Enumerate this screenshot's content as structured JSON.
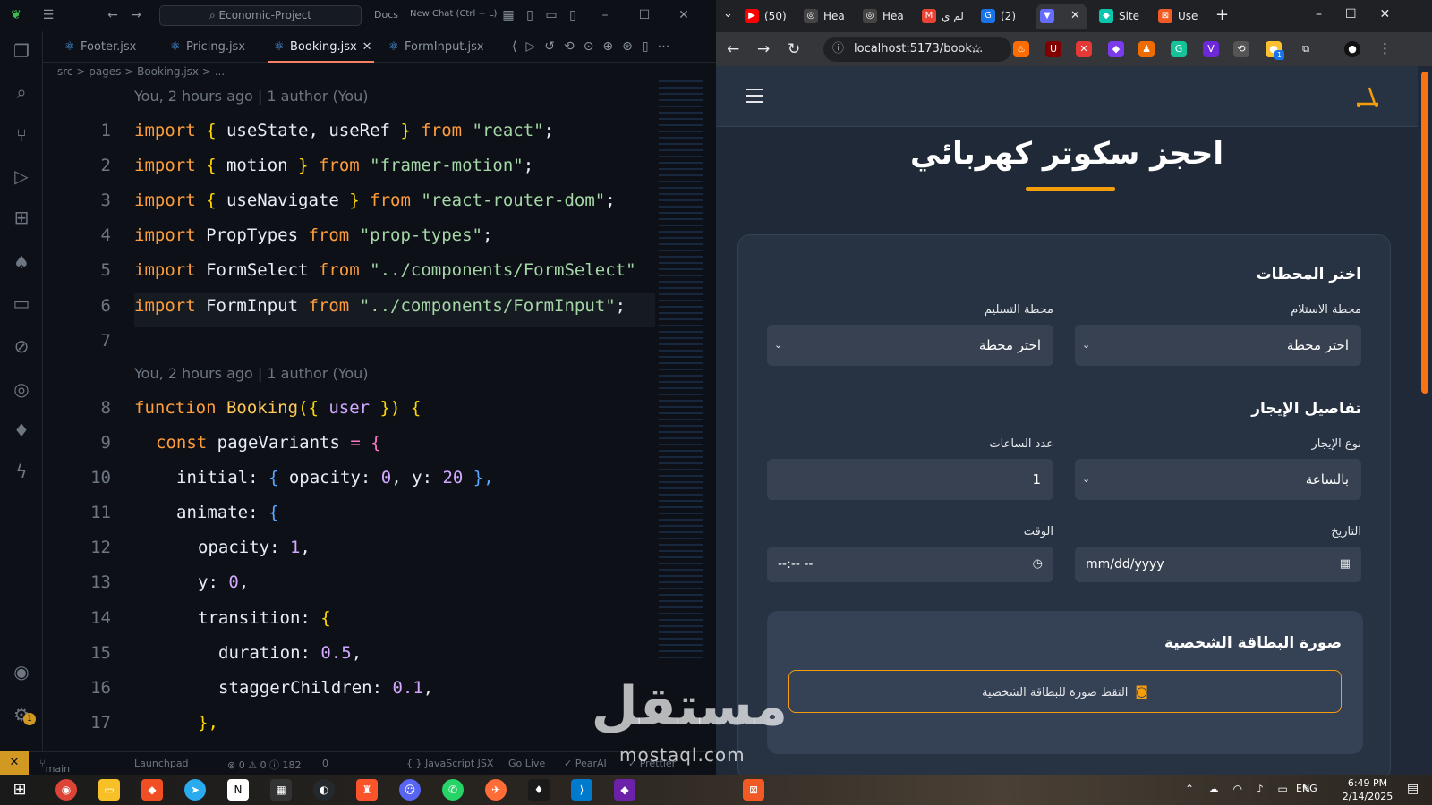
{
  "vscode": {
    "search": "Economic-Project",
    "docs": "Docs",
    "new_chat": "New Chat (Ctrl + L)",
    "tabs": [
      {
        "label": "Footer.jsx"
      },
      {
        "label": "Pricing.jsx"
      },
      {
        "label": "Booking.jsx"
      },
      {
        "label": "FormInput.jsx"
      }
    ],
    "tab_close": "✕",
    "breadcrumb": "src > pages > Booking.jsx > ...",
    "blame1": "You, 2 hours ago | 1 author (You)",
    "blame2": "You, 2 hours ago | 1 author (You)",
    "line_numbers": [
      "1",
      "2",
      "3",
      "4",
      "5",
      "6",
      "7",
      "8",
      "9",
      "10",
      "11",
      "12",
      "13",
      "14",
      "15",
      "16",
      "17"
    ],
    "code": {
      "l1": {
        "a": "import",
        "b": " { ",
        "c": "useState, useRef",
        "d": " } ",
        "e": "from",
        "f": " \"react\"",
        "g": ";"
      },
      "l2": {
        "a": "import",
        "b": " { ",
        "c": "motion",
        "d": " } ",
        "e": "from",
        "f": " \"framer-motion\"",
        "g": ";"
      },
      "l3": {
        "a": "import",
        "b": " { ",
        "c": "useNavigate",
        "d": " } ",
        "e": "from",
        "f": " \"react-router-dom\"",
        "g": ";"
      },
      "l4": {
        "a": "import",
        "c": " PropTypes ",
        "e": "from",
        "f": " \"prop-types\"",
        "g": ";"
      },
      "l5": {
        "a": "import",
        "c": " FormSelect ",
        "e": "from",
        "f": " \"../components/FormSelect\""
      },
      "l6": {
        "a": "import",
        "c": " FormInput ",
        "e": "from",
        "f": " \"../components/FormInput\"",
        "g": ";"
      },
      "l8": {
        "a": "function ",
        "b": "Booking",
        "c": "({ ",
        "d": "user",
        "e": " }) {"
      },
      "l9": {
        "a": "const ",
        "b": "pageVariants ",
        "c": "= {"
      },
      "l10": {
        "a": "initial: ",
        "b": "{ ",
        "c": "opacity: ",
        "d": "0",
        "e": ", y: ",
        "f": "20",
        "g": " },"
      },
      "l11": {
        "a": "animate: ",
        "b": "{"
      },
      "l12": {
        "a": "opacity: ",
        "b": "1",
        "c": ","
      },
      "l13": {
        "a": "y: ",
        "b": "0",
        "c": ","
      },
      "l14": {
        "a": "transition: ",
        "b": "{"
      },
      "l15": {
        "a": "duration: ",
        "b": "0.5",
        "c": ","
      },
      "l16": {
        "a": "staggerChildren: ",
        "b": "0.1",
        "c": ","
      },
      "l17": {
        "a": "},"
      }
    },
    "status": {
      "branch": "main",
      "launchpad": "Launchpad",
      "problems": "⊗ 0 ⚠ 0 ⓘ 182",
      "ports": "0",
      "lang": "{ } JavaScript JSX",
      "golive": "Go Live",
      "pearai": "✓ PearAI",
      "prettier": "✓ Prettier"
    },
    "settings_badge": "1"
  },
  "browser": {
    "tabs": [
      {
        "label": "(50)"
      },
      {
        "label": "Hea"
      },
      {
        "label": "Hea"
      },
      {
        "label": "لم ي"
      },
      {
        "label": "(2)"
      },
      {
        "label": ""
      },
      {
        "label": "Site"
      },
      {
        "label": "Use"
      }
    ],
    "url": "localhost:5173/book...",
    "ext_badge": "1"
  },
  "page": {
    "title": "احجز سكوتر كهربائي",
    "section_stations": "اختر المحطات",
    "pickup_label": "محطة الاستلام",
    "pickup_value": "اختر محطة",
    "dropoff_label": "محطة التسليم",
    "dropoff_value": "اختر محطة",
    "section_rental": "تفاصيل الإيجار",
    "rent_type_label": "نوع الإيجار",
    "rent_type_value": "بالساعة",
    "hours_label": "عدد الساعات",
    "hours_value": "1",
    "date_label": "التاريخ",
    "date_value": "mm/dd/yyyy",
    "time_label": "الوقت",
    "time_value": "--:-- --",
    "id_title": "صورة البطاقة الشخصية",
    "id_button": "التقط صورة للبطاقة الشخصية"
  },
  "watermark": {
    "ar": "مستقل",
    "en": "mostaql.com"
  },
  "taskbar": {
    "lang": "ENG",
    "time": "6:49 PM",
    "date": "2/14/2025"
  },
  "colors": {
    "accent": "#f59e0b",
    "page_bg": "#1f2937",
    "card_bg": "#273243",
    "input_bg": "#374151",
    "editor_bg": "#0d1117"
  }
}
